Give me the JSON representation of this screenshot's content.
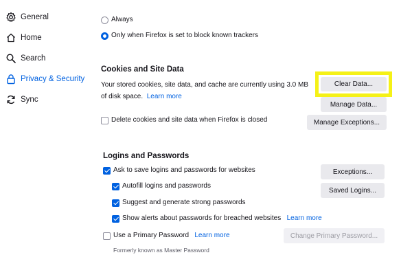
{
  "sidebar": {
    "items": [
      {
        "label": "General",
        "icon": "gear-icon"
      },
      {
        "label": "Home",
        "icon": "home-icon"
      },
      {
        "label": "Search",
        "icon": "search-icon"
      },
      {
        "label": "Privacy & Security",
        "icon": "lock-icon",
        "active": true
      },
      {
        "label": "Sync",
        "icon": "sync-icon"
      }
    ]
  },
  "tracking": {
    "option_always": "Always",
    "option_when_blocking": "Only when Firefox is set to block known trackers",
    "selected": "option_when_blocking"
  },
  "cookies": {
    "heading": "Cookies and Site Data",
    "usage_text_line1": "Your stored cookies, site data, and cache are currently using 3.0 MB",
    "usage_text_line2": "of disk space.",
    "learn_more": "Learn more",
    "delete_on_close_label": "Delete cookies and site data when Firefox is closed",
    "delete_on_close_checked": false,
    "clear_data_button": "Clear Data...",
    "manage_data_button": "Manage Data...",
    "manage_exceptions_button": "Manage Exceptions..."
  },
  "logins": {
    "heading": "Logins and Passwords",
    "ask_to_save_label": "Ask to save logins and passwords for websites",
    "autofill_label": "Autofill logins and passwords",
    "suggest_label": "Suggest and generate strong passwords",
    "breach_alerts_label": "Show alerts about passwords for breached websites",
    "learn_more": "Learn more",
    "primary_password_label": "Use a Primary Password",
    "primary_password_learn_more": "Learn more",
    "formerly_known": "Formerly known as Master Password",
    "exceptions_button": "Exceptions...",
    "saved_logins_button": "Saved Logins...",
    "change_primary_password_button": "Change Primary Password..."
  },
  "colors": {
    "accent": "#0061e0",
    "highlight": "#f5f117",
    "button_bg": "#e9e9ed"
  }
}
